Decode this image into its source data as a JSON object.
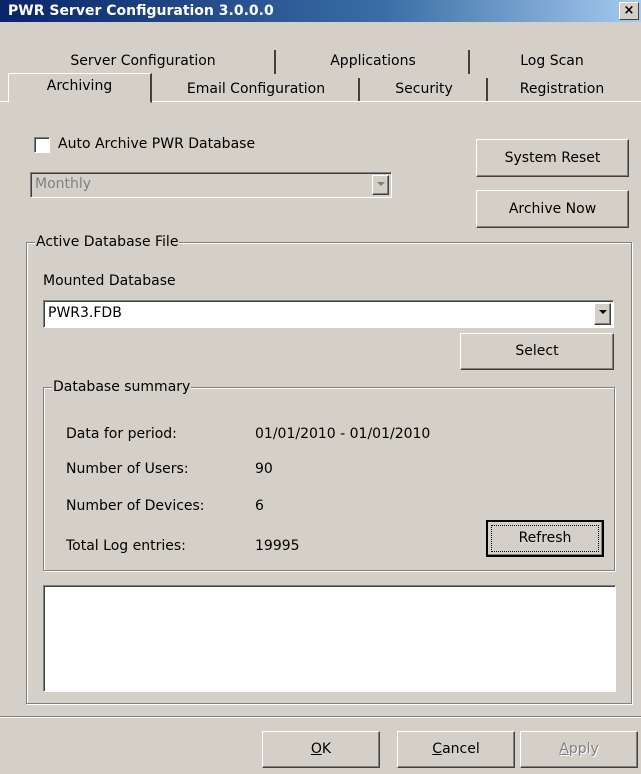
{
  "window": {
    "title": "PWR Server Configuration 3.0.0.0",
    "close_glyph": "×"
  },
  "tabs": {
    "row_back": [
      "Server Configuration",
      "Applications",
      "Log Scan"
    ],
    "row_front": [
      "Archiving",
      "Email Configuration",
      "Security",
      "Registration"
    ],
    "active": "Archiving"
  },
  "archiving": {
    "auto_archive_label": "Auto Archive PWR Database",
    "auto_archive_checked": false,
    "frequency_value": "Monthly",
    "system_reset_label": "System Reset",
    "archive_now_label": "Archive Now"
  },
  "active_db": {
    "group_label": "Active Database File",
    "mounted_label": "Mounted Database",
    "mounted_value": "PWR3.FDB",
    "select_label": "Select"
  },
  "summary": {
    "group_label": "Database summary",
    "rows": [
      {
        "label": "Data for period:",
        "value": "01/01/2010 - 01/01/2010"
      },
      {
        "label": "Number of Users:",
        "value": "90"
      },
      {
        "label": "Number of Devices:",
        "value": "6"
      },
      {
        "label": "Total Log entries:",
        "value": "19995"
      }
    ],
    "refresh_label": "Refresh"
  },
  "footer": {
    "ok_prefix": "",
    "ok_mnemonic": "O",
    "ok_rest": "K",
    "cancel_mnemonic": "C",
    "cancel_rest": "ancel",
    "apply_mnemonic": "A",
    "apply_rest": "pply"
  }
}
